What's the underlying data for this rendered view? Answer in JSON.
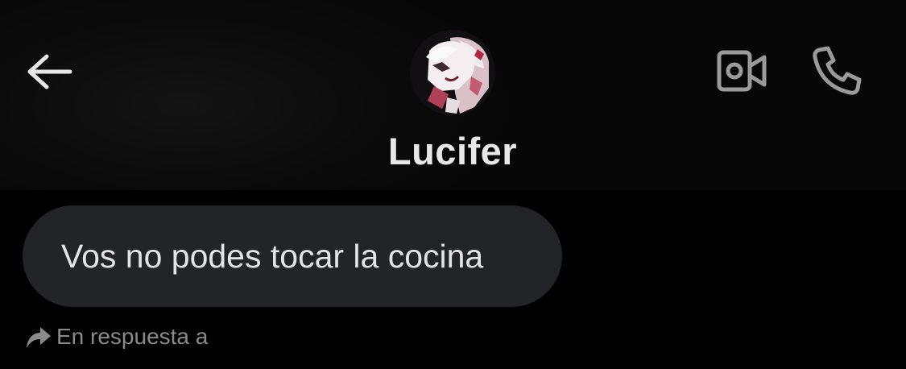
{
  "header": {
    "back_icon": "arrow-left-icon",
    "contact_name": "Lucifer",
    "video_icon": "video-camera-icon",
    "call_icon": "phone-icon"
  },
  "messages": [
    {
      "text": "Vos no podes tocar la cocina"
    }
  ],
  "reply": {
    "icon": "reply-arrow-icon",
    "label": "En respuesta a"
  },
  "colors": {
    "background": "#000000",
    "bubble": "#222428",
    "text_primary": "#e4e4e4",
    "text_secondary": "#8a8a8a",
    "icon": "#9a9a9a"
  }
}
